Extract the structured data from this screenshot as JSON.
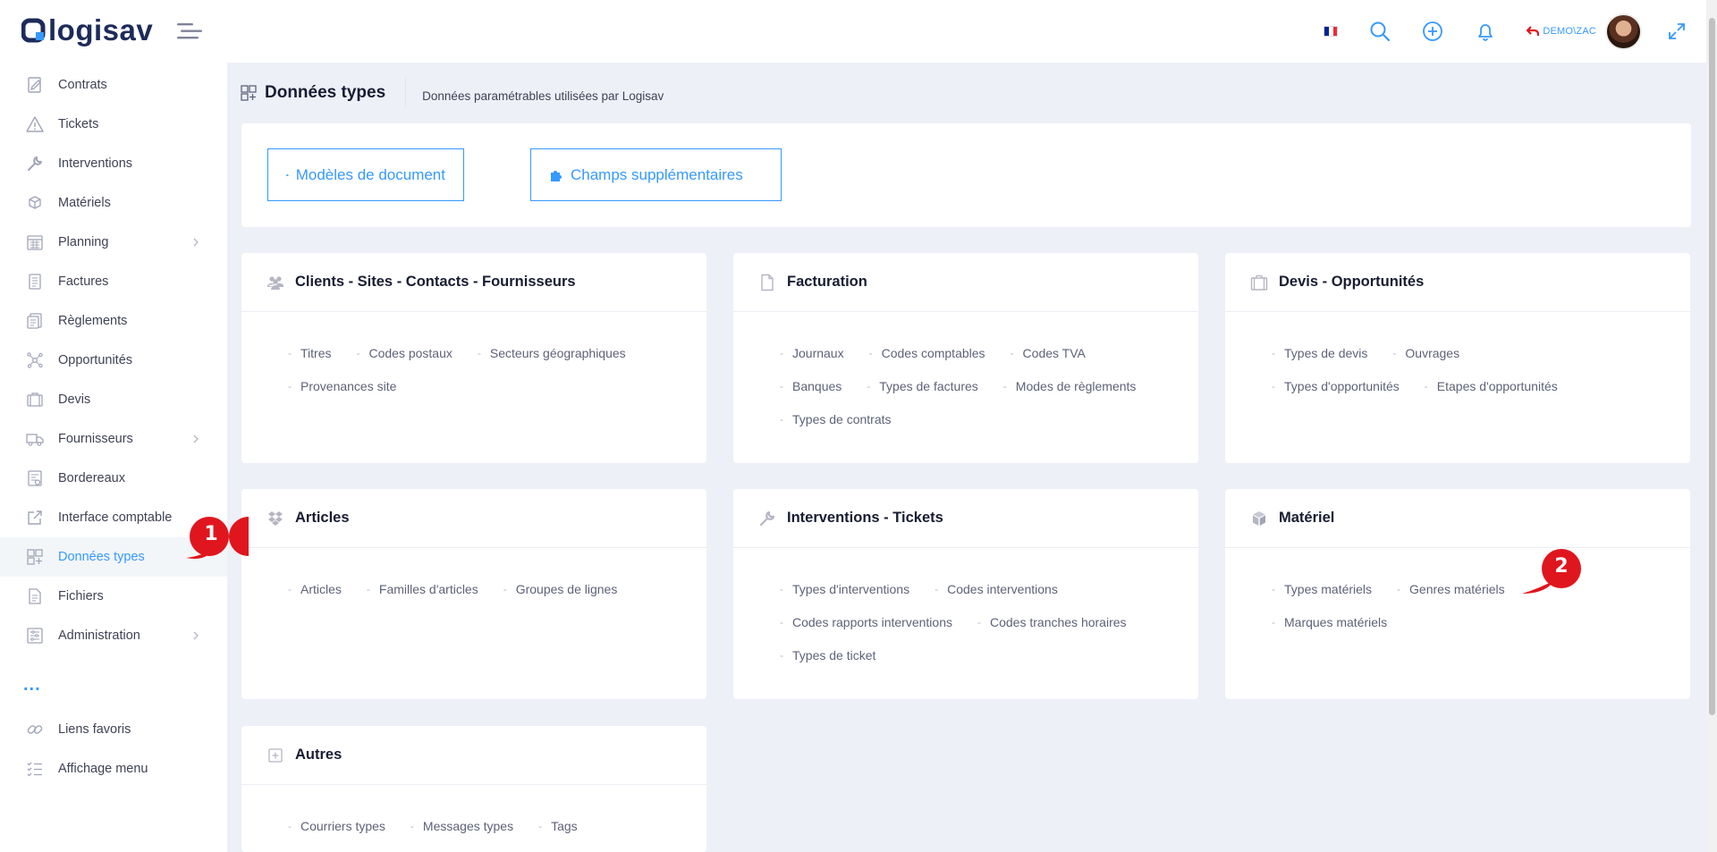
{
  "brand": {
    "name": "logisav"
  },
  "header": {
    "user_label": "DEMO\\ZAC",
    "flag_colors": [
      "#002395",
      "#ffffff",
      "#ed2939"
    ],
    "icons": [
      "search-icon",
      "add-icon",
      "bell-icon",
      "expand-icon"
    ]
  },
  "sidebar": {
    "items": [
      {
        "label": "Contrats",
        "icon": "contract-icon"
      },
      {
        "label": "Tickets",
        "icon": "warning-icon"
      },
      {
        "label": "Interventions",
        "icon": "wrench-icon"
      },
      {
        "label": "Matériels",
        "icon": "cube-icon"
      },
      {
        "label": "Planning",
        "icon": "calendar-icon",
        "submenu": true
      },
      {
        "label": "Factures",
        "icon": "invoice-icon"
      },
      {
        "label": "Règlements",
        "icon": "payment-icon"
      },
      {
        "label": "Opportunités",
        "icon": "network-icon"
      },
      {
        "label": "Devis",
        "icon": "briefcase-icon"
      },
      {
        "label": "Fournisseurs",
        "icon": "truck-icon",
        "submenu": true
      },
      {
        "label": "Bordereaux",
        "icon": "slip-icon"
      },
      {
        "label": "Interface comptable",
        "icon": "external-link-icon"
      },
      {
        "label": "Données types",
        "icon": "grid-icon",
        "active": true
      },
      {
        "label": "Fichiers",
        "icon": "file-icon"
      },
      {
        "label": "Administration",
        "icon": "admin-icon",
        "submenu": true
      }
    ],
    "more_label": "...",
    "bottom_items": [
      {
        "label": "Liens favoris",
        "icon": "link-icon"
      },
      {
        "label": "Affichage menu",
        "icon": "list-check-icon"
      }
    ]
  },
  "subheader": {
    "title": "Données types",
    "description": "Données paramétrables utilisées par Logisav"
  },
  "actions": {
    "document_models": "Modèles de document",
    "extra_fields": "Champs supplémentaires"
  },
  "cards": [
    {
      "title": "Clients - Sites - Contacts - Fournisseurs",
      "icon": "users-icon",
      "rows": [
        [
          "Titres",
          "Codes postaux",
          "Secteurs géographiques"
        ],
        [
          "Provenances site"
        ]
      ]
    },
    {
      "title": "Facturation",
      "icon": "document-icon",
      "rows": [
        [
          "Journaux",
          "Codes comptables",
          "Codes TVA"
        ],
        [
          "Banques",
          "Types de factures",
          "Modes de règlements"
        ],
        [
          "Types de contrats"
        ]
      ]
    },
    {
      "title": "Devis - Opportunités",
      "icon": "briefcase-icon",
      "rows": [
        [
          "Types de devis",
          "Ouvrages"
        ],
        [
          "Types d'opportunités",
          "Etapes d'opportunités"
        ]
      ]
    },
    {
      "title": "Articles",
      "icon": "dropbox-icon",
      "rows": [
        [
          "Articles",
          "Familles d'articles",
          "Groupes de lignes"
        ]
      ]
    },
    {
      "title": "Interventions - Tickets",
      "icon": "wrench-icon",
      "rows": [
        [
          "Types d'interventions",
          "Codes interventions"
        ],
        [
          "Codes rapports interventions",
          "Codes tranches horaires"
        ],
        [
          "Types de ticket"
        ]
      ]
    },
    {
      "title": "Matériel",
      "icon": "cube-icon",
      "rows": [
        [
          "Types matériels",
          "Genres matériels"
        ],
        [
          "Marques matériels"
        ]
      ]
    },
    {
      "title": "Autres",
      "icon": "plus-square-icon",
      "rows": [
        [
          "Courriers types",
          "Messages types",
          "Tags"
        ]
      ]
    }
  ],
  "markers": [
    "1",
    "2"
  ],
  "colors": {
    "accent": "#3699ff",
    "marker": "#e0161e",
    "background": "#eef0f8"
  }
}
